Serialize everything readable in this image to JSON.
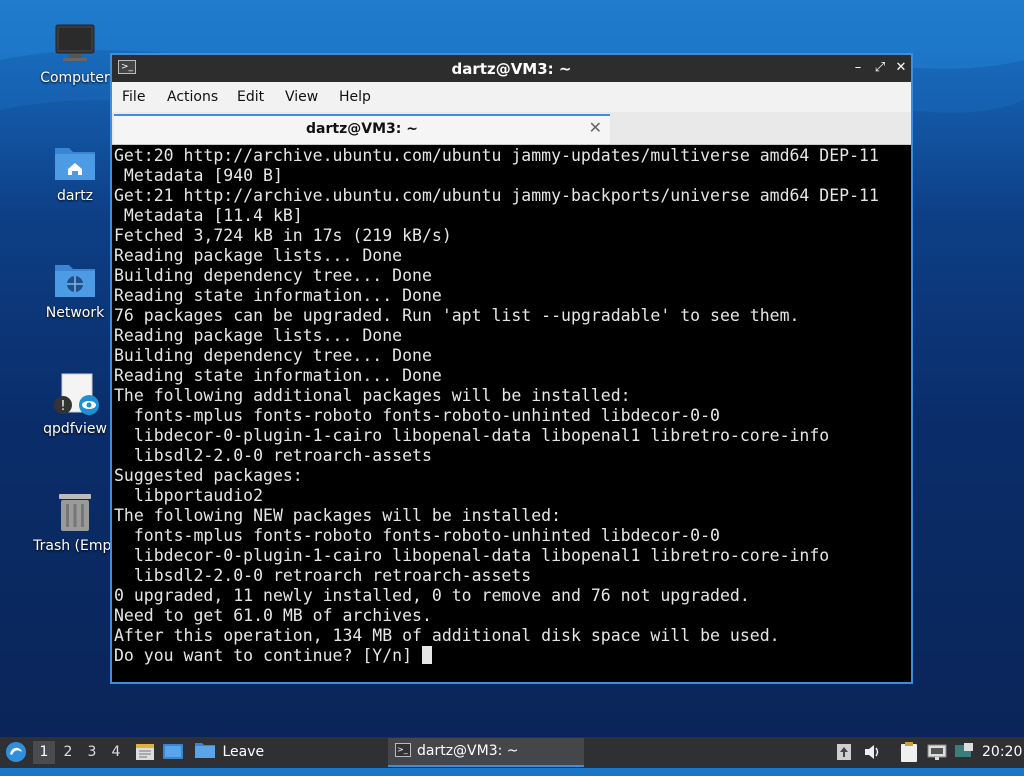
{
  "desktop": {
    "icons": [
      {
        "label": "Computer"
      },
      {
        "label": "dartz"
      },
      {
        "label": "Network"
      },
      {
        "label": "qpdfview"
      },
      {
        "label": "Trash (Empt"
      }
    ]
  },
  "window": {
    "title": "dartz@VM3: ~",
    "icon_glyph": ">_",
    "controls": {
      "minimize": "–",
      "maximize": "⤢",
      "close": "✕"
    },
    "menu": [
      "File",
      "Actions",
      "Edit",
      "View",
      "Help"
    ],
    "tab": {
      "label": "dartz@VM3: ~",
      "close": "✕"
    }
  },
  "terminal": {
    "lines": [
      "Get:20 http://archive.ubuntu.com/ubuntu jammy-updates/multiverse amd64 DEP-11",
      " Metadata [940 B]",
      "Get:21 http://archive.ubuntu.com/ubuntu jammy-backports/universe amd64 DEP-11",
      " Metadata [11.4 kB]",
      "Fetched 3,724 kB in 17s (219 kB/s)",
      "Reading package lists... Done",
      "Building dependency tree... Done",
      "Reading state information... Done",
      "76 packages can be upgraded. Run 'apt list --upgradable' to see them.",
      "Reading package lists... Done",
      "Building dependency tree... Done",
      "Reading state information... Done",
      "The following additional packages will be installed:",
      "  fonts-mplus fonts-roboto fonts-roboto-unhinted libdecor-0-0",
      "  libdecor-0-plugin-1-cairo libopenal-data libopenal1 libretro-core-info",
      "  libsdl2-2.0-0 retroarch-assets",
      "Suggested packages:",
      "  libportaudio2",
      "The following NEW packages will be installed:",
      "  fonts-mplus fonts-roboto fonts-roboto-unhinted libdecor-0-0",
      "  libdecor-0-plugin-1-cairo libopenal-data libopenal1 libretro-core-info",
      "  libsdl2-2.0-0 retroarch retroarch-assets",
      "0 upgraded, 11 newly installed, 0 to remove and 76 not upgraded.",
      "Need to get 61.0 MB of archives.",
      "After this operation, 134 MB of additional disk space will be used.",
      "Do you want to continue? [Y/n] "
    ]
  },
  "taskbar": {
    "workspaces": [
      "1",
      "2",
      "3",
      "4"
    ],
    "leave_label": "Leave",
    "task_label": "dartz@VM3: ~",
    "clock": "20:20"
  },
  "colors": {
    "accent": "#3d8ee0",
    "taskbar": "#2f3033",
    "terminal_bg": "#000000"
  }
}
